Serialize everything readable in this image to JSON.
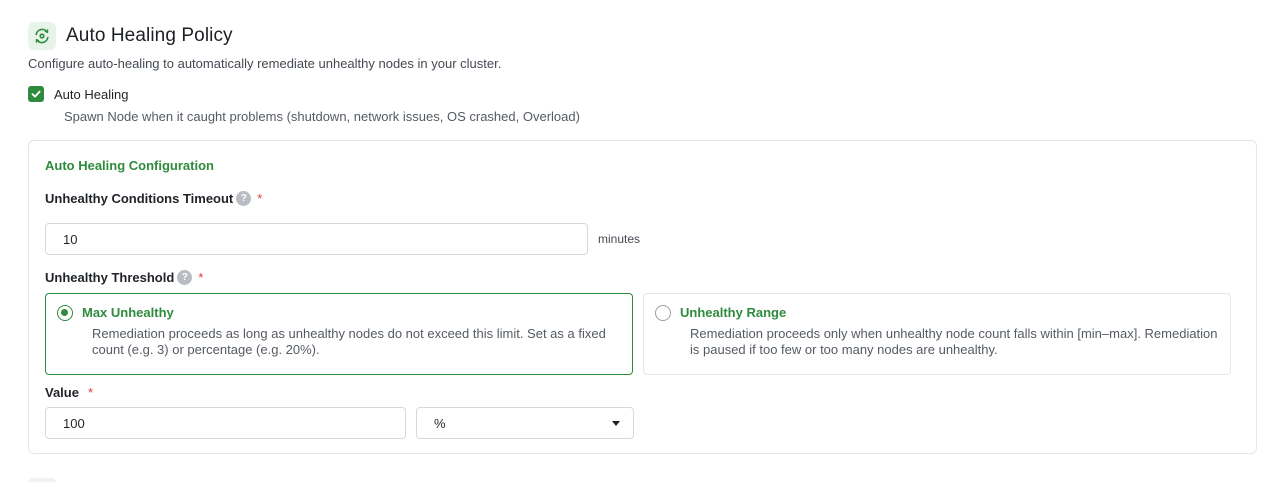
{
  "header": {
    "title": "Auto Healing Policy",
    "icon": "heal-cycle-icon"
  },
  "subtitle": "Configure auto-healing to automatically remediate unhealthy nodes in your cluster.",
  "auto_healing": {
    "checked": true,
    "label": "Auto Healing",
    "description": "Spawn Node when it caught problems (shutdown, network issues, OS crashed, Overload)"
  },
  "config": {
    "title": "Auto Healing Configuration",
    "timeout": {
      "label": "Unhealthy Conditions Timeout",
      "required_mark": "*",
      "value": "10",
      "unit": "minutes"
    },
    "threshold": {
      "label": "Unhealthy Threshold",
      "required_mark": "*",
      "options": [
        {
          "title": "Max Unhealthy",
          "selected": true,
          "description": "Remediation proceeds as long as unhealthy nodes do not exceed this limit. Set as a fixed count (e.g. 3) or percentage (e.g. 20%)."
        },
        {
          "title": "Unhealthy Range",
          "selected": false,
          "description": "Remediation proceeds only when unhealthy node count falls within [min–max]. Remediation is paused if too few or too many nodes are unhealthy."
        }
      ]
    },
    "value": {
      "label": "Value",
      "required_mark": "*",
      "value": "100",
      "unit_selected": "%"
    }
  },
  "colors": {
    "accent": "#2e8b3e",
    "required": "#e03a3a",
    "border": "#e3e6ea"
  }
}
